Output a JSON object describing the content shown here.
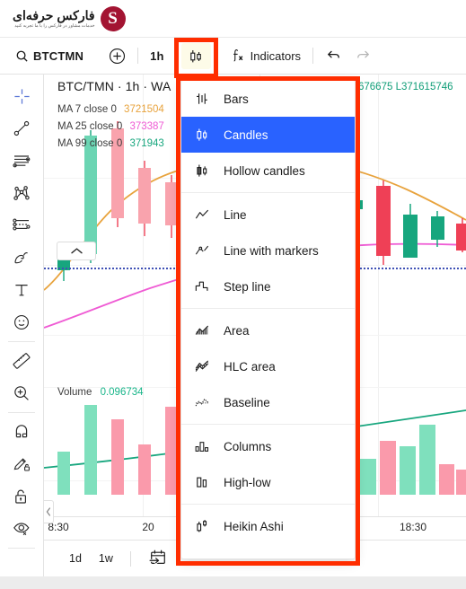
{
  "brand": {
    "name": "فارکس حرفه‌ای",
    "tagline": "خدمات مشاور در فارکس را با ما تجربه کنید",
    "mark": "S",
    "mark_color": "#a31432"
  },
  "toolbar": {
    "search_icon": "search-icon",
    "symbol": "BTCTMN",
    "add_label": "+",
    "interval": "1h",
    "chart_style_icon": "candles-icon",
    "indicators_icon": "fx-icon",
    "indicators_label": "Indicators",
    "undo_icon": "undo-arrow-icon",
    "redo_icon": "redo-arrow-icon"
  },
  "left_rail": {
    "items": [
      {
        "name": "crosshair-icon",
        "selected": true
      },
      {
        "name": "trend-line-icon",
        "selected": false
      },
      {
        "name": "horizontal-lines-icon",
        "selected": false
      },
      {
        "name": "pitchfork-icon",
        "selected": false
      },
      {
        "name": "fib-retracement-icon",
        "selected": false
      },
      {
        "name": "brush-icon",
        "selected": false
      },
      {
        "name": "text-tool-icon",
        "selected": false
      },
      {
        "name": "emoji-icon",
        "selected": false
      },
      {
        "name": "ruler-icon",
        "selected": false
      },
      {
        "name": "zoom-in-icon",
        "selected": false
      },
      {
        "name": "magnet-icon",
        "selected": false
      },
      {
        "name": "drawing-mode-icon",
        "selected": false
      },
      {
        "name": "lock-drawings-icon",
        "selected": false
      },
      {
        "name": "hide-drawings-icon",
        "selected": false
      }
    ]
  },
  "chart": {
    "legend_title": "BTC/TMN · 1h · WA",
    "ohlc_partial": "676675  L371615746",
    "ma_rows": [
      {
        "label": "MA 7 close 0",
        "value": "3721504",
        "color": "#e8a33d"
      },
      {
        "label": "MA 25 close 0",
        "value": "373387",
        "color": "#ef5bd4"
      },
      {
        "label": "MA 99 close 0",
        "value": "371943",
        "color": "#17a67e"
      }
    ],
    "volume_label": "Volume",
    "volume_value": "0.096734",
    "time_labels": [
      "8:30",
      "20",
      "18:30"
    ],
    "collapse_icon": "chevron-left-icon",
    "colors": {
      "up": "#17a67e",
      "down": "#ef4056",
      "up_volume": "#7fe0bd",
      "down_volume": "#fa9aab",
      "ma7": "#e8a33d",
      "ma25": "#ef5bd4",
      "ma99": "#17a67e",
      "marker_line": "#3f51b5"
    }
  },
  "chart_data": {
    "type": "candlestick",
    "title": "BTC/TMN · 1h",
    "xlabel": "",
    "ylabel": "",
    "time_ticks": [
      "8:30",
      "20",
      "18:30"
    ],
    "series": [
      {
        "name": "price-candles",
        "candles": [
          {
            "o": 32,
            "h": 36,
            "l": 28,
            "c": 34,
            "dir": "up"
          },
          {
            "o": 34,
            "h": 62,
            "l": 33,
            "c": 60,
            "dir": "up"
          },
          {
            "o": 61,
            "h": 66,
            "l": 52,
            "c": 53,
            "dir": "down"
          },
          {
            "o": 54,
            "h": 58,
            "l": 46,
            "c": 48,
            "dir": "down"
          },
          {
            "o": 49,
            "h": 53,
            "l": 44,
            "c": 45,
            "dir": "down"
          },
          {
            "o": 45,
            "h": 47,
            "l": 40,
            "c": 42,
            "dir": "down"
          },
          {
            "o": 43,
            "h": 50,
            "l": 38,
            "c": 39,
            "dir": "down"
          },
          {
            "o": 40,
            "h": 46,
            "l": 35,
            "c": 44,
            "dir": "up"
          },
          {
            "o": 44,
            "h": 52,
            "l": 40,
            "c": 41,
            "dir": "down"
          },
          {
            "o": 41,
            "h": 55,
            "l": 36,
            "c": 50,
            "dir": "up"
          },
          {
            "o": 51,
            "h": 58,
            "l": 45,
            "c": 46,
            "dir": "down"
          },
          {
            "o": 46,
            "h": 49,
            "l": 41,
            "c": 47,
            "dir": "up"
          },
          {
            "o": 47,
            "h": 52,
            "l": 38,
            "c": 40,
            "dir": "down"
          },
          {
            "o": 40,
            "h": 44,
            "l": 33,
            "c": 38,
            "dir": "down"
          },
          {
            "o": 38,
            "h": 42,
            "l": 31,
            "c": 36,
            "dir": "up"
          }
        ]
      },
      {
        "name": "MA 7",
        "color": "#e8a33d"
      },
      {
        "name": "MA 25",
        "color": "#ef5bd4"
      },
      {
        "name": "MA 99",
        "color": "#17a67e"
      }
    ],
    "volume": {
      "name": "Volume",
      "last_value": 0.096734,
      "bars": [
        {
          "v": 62,
          "dir": "up"
        },
        {
          "v": 78,
          "dir": "down"
        },
        {
          "v": 48,
          "dir": "down"
        },
        {
          "v": 30,
          "dir": "down"
        },
        {
          "v": 95,
          "dir": "down"
        },
        {
          "v": 22,
          "dir": "down"
        },
        {
          "v": 40,
          "dir": "up"
        },
        {
          "v": 58,
          "dir": "down"
        },
        {
          "v": 52,
          "dir": "up"
        },
        {
          "v": 85,
          "dir": "up"
        },
        {
          "v": 28,
          "dir": "down"
        },
        {
          "v": 24,
          "dir": "down"
        },
        {
          "v": 68,
          "dir": "up"
        },
        {
          "v": 45,
          "dir": "up"
        }
      ]
    }
  },
  "chart_style_menu": {
    "groups": [
      {
        "items": [
          {
            "label": "Bars",
            "icon": "bars-chart-icon",
            "active": false
          },
          {
            "label": "Candles",
            "icon": "candles-chart-icon",
            "active": true
          },
          {
            "label": "Hollow candles",
            "icon": "hollow-candles-chart-icon",
            "active": false
          }
        ]
      },
      {
        "items": [
          {
            "label": "Line",
            "icon": "line-chart-icon",
            "active": false
          },
          {
            "label": "Line with markers",
            "icon": "line-markers-chart-icon",
            "active": false
          },
          {
            "label": "Step line",
            "icon": "step-line-chart-icon",
            "active": false
          }
        ]
      },
      {
        "items": [
          {
            "label": "Area",
            "icon": "area-chart-icon",
            "active": false
          },
          {
            "label": "HLC area",
            "icon": "hlc-area-chart-icon",
            "active": false
          },
          {
            "label": "Baseline",
            "icon": "baseline-chart-icon",
            "active": false
          }
        ]
      },
      {
        "items": [
          {
            "label": "Columns",
            "icon": "columns-chart-icon",
            "active": false
          },
          {
            "label": "High-low",
            "icon": "high-low-chart-icon",
            "active": false
          }
        ]
      },
      {
        "items": [
          {
            "label": "Heikin Ashi",
            "icon": "heikin-ashi-chart-icon",
            "active": false
          }
        ]
      }
    ]
  },
  "bottom_bar": {
    "ranges": [
      "1d",
      "1w"
    ],
    "calendar_icon": "go-to-date-icon"
  },
  "annotations": {
    "color": "#ff2d00",
    "boxes": [
      "chart-style-toolbar-button",
      "chart-style-dropdown-menu"
    ]
  }
}
